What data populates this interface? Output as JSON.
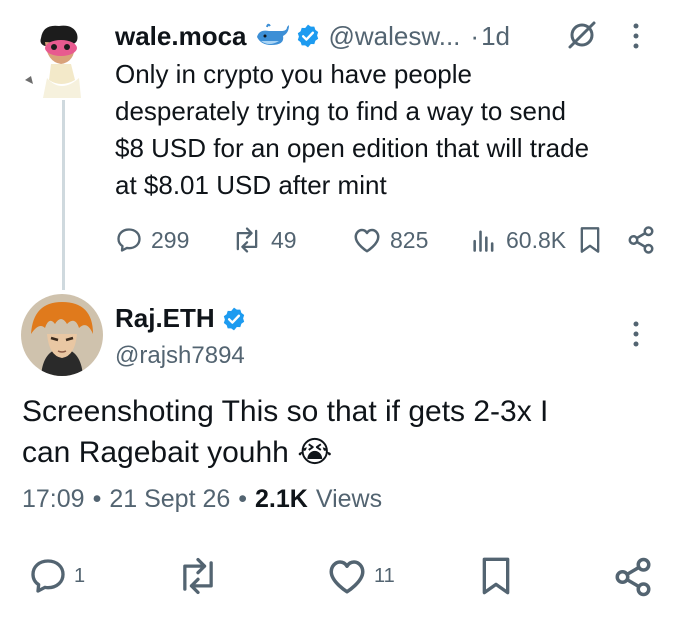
{
  "tweet": {
    "author_name": "wale.moca",
    "author_emoji": "🐳",
    "handle": "@walesw...",
    "separator": "·",
    "time": "1d",
    "text_lines": [
      "Only in crypto you have people",
      "desperately trying to find a way to send",
      "$8 USD for an open edition that will trade",
      "at $8.01 USD after mint"
    ],
    "replies": "299",
    "reposts": "49",
    "likes": "825",
    "views": "60.8K"
  },
  "reply": {
    "author_name": "Raj.ETH",
    "handle": "@rajsh7894",
    "text_lines": [
      "Screenshoting This so that if gets 2-3x I",
      "can Ragebait youhh 😭"
    ],
    "time": "17:09",
    "date": "21 Sept 26",
    "dot": "•",
    "views_count": "2.1K",
    "views_label": "Views",
    "replies": "1",
    "likes": "11"
  },
  "colors": {
    "text": "#0f1419",
    "secondary": "#536471",
    "verified": "#1d9bf0",
    "thread_line": "#cfd9de"
  },
  "icons": [
    "verified-badge-icon",
    "whale-icon",
    "grok-icon",
    "more-icon",
    "reply-icon",
    "repost-icon",
    "like-icon",
    "views-icon",
    "bookmark-icon",
    "share-icon"
  ]
}
